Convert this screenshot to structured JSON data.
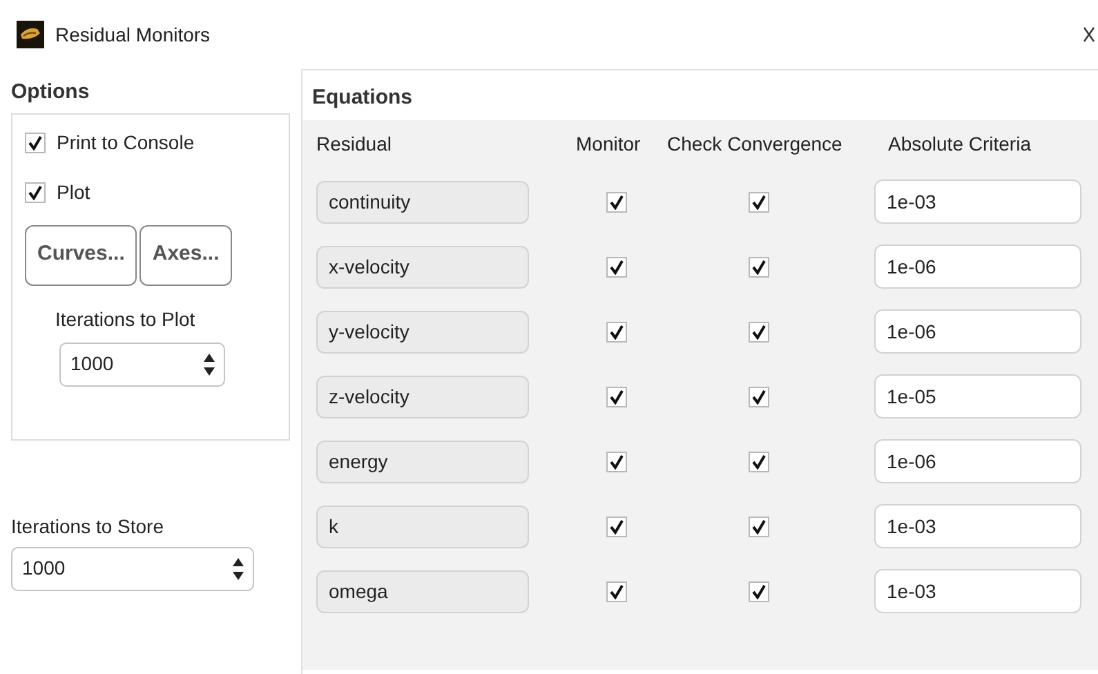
{
  "window": {
    "title": "Residual Monitors"
  },
  "options": {
    "title": "Options",
    "checkboxes": [
      {
        "label": "Print to Console",
        "checked": true
      },
      {
        "label": "Plot",
        "checked": true
      }
    ],
    "buttons": [
      "Curves...",
      "Axes..."
    ],
    "iterations_to_plot": {
      "label": "Iterations to Plot",
      "value": "1000"
    }
  },
  "iterations_to_store": {
    "label": "Iterations to Store",
    "value": "1000"
  },
  "equations": {
    "title": "Equations",
    "columns": [
      "Residual",
      "Monitor",
      "Check Convergence",
      "Absolute Criteria"
    ],
    "rows": [
      {
        "residual": "continuity",
        "monitor": true,
        "check_convergence": true,
        "absolute_criteria": "1e-03"
      },
      {
        "residual": "x-velocity",
        "monitor": true,
        "check_convergence": true,
        "absolute_criteria": "1e-06"
      },
      {
        "residual": "y-velocity",
        "monitor": true,
        "check_convergence": true,
        "absolute_criteria": "1e-06"
      },
      {
        "residual": "z-velocity",
        "monitor": true,
        "check_convergence": true,
        "absolute_criteria": "1e-05"
      },
      {
        "residual": "energy",
        "monitor": true,
        "check_convergence": true,
        "absolute_criteria": "1e-06"
      },
      {
        "residual": "k",
        "monitor": true,
        "check_convergence": true,
        "absolute_criteria": "1e-03"
      },
      {
        "residual": "omega",
        "monitor": true,
        "check_convergence": true,
        "absolute_criteria": "1e-03"
      }
    ]
  }
}
